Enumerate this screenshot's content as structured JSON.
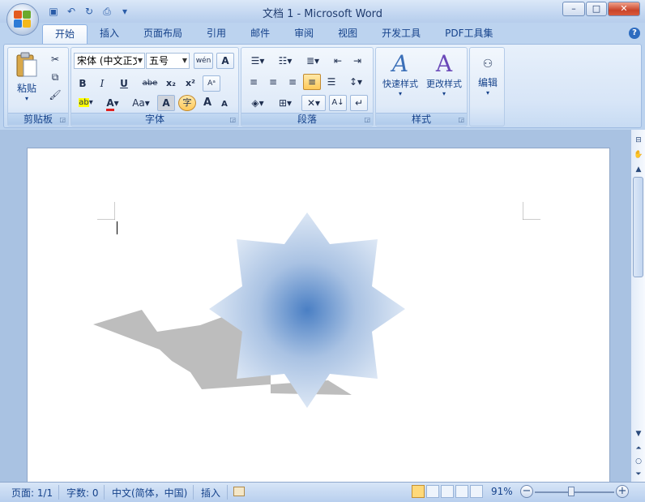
{
  "window": {
    "title": "文档 1 - Microsoft Word",
    "minimize": "–",
    "maximize": "□",
    "close": "✕"
  },
  "tabs": [
    "开始",
    "插入",
    "页面布局",
    "引用",
    "邮件",
    "审阅",
    "视图",
    "开发工具",
    "PDF工具集"
  ],
  "help_icon": "?",
  "ribbon": {
    "clipboard": {
      "label": "剪贴板",
      "paste_label": "粘贴"
    },
    "font": {
      "label": "字体",
      "font_name": "宋体 (中文正文",
      "font_size": "五号",
      "bold": "B",
      "italic": "I",
      "underline": "U",
      "strike": "abe",
      "subscript": "x₂",
      "superscript": "x²",
      "grow": "A",
      "shrink": "A",
      "change_case": "Aa",
      "char_shade": "A",
      "enclose": "字",
      "highlight": "ab",
      "font_color": "A",
      "wen": "wén"
    },
    "paragraph": {
      "label": "段落"
    },
    "styles": {
      "label": "样式",
      "quick_styles": "快速样式",
      "change_styles": "更改样式"
    },
    "editing": {
      "label": "编辑"
    }
  },
  "status": {
    "page": "页面: 1/1",
    "words": "字数: 0",
    "language": "中文(简体，中国)",
    "mode": "插入",
    "zoom": "91%",
    "zoom_minus": "−",
    "zoom_plus": "+",
    "zoom_level": 0.46
  },
  "colors": {
    "accent": "#15428b",
    "star_center": "#4a7fc4",
    "star_edge": "#dfe8f5",
    "shadow": "#bdbdbd"
  }
}
